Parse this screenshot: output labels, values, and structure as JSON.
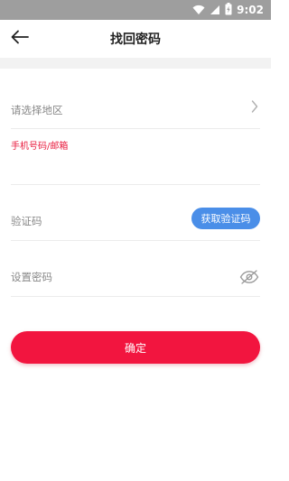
{
  "status_bar": {
    "time": "9:02",
    "icons": [
      "wifi-icon",
      "signal-icon",
      "battery-charging-icon"
    ],
    "background": "#9e9e9e"
  },
  "header": {
    "title": "找回密码",
    "back_icon": "arrow-left-icon"
  },
  "form": {
    "region": {
      "placeholder": "请选择地区",
      "icon": "chevron-right-icon"
    },
    "phone": {
      "label": "手机号码/邮箱",
      "value": "",
      "label_color": "#e8193c"
    },
    "code": {
      "placeholder": "验证码",
      "button_label": "获取验证码",
      "button_color": "#4a8ee8"
    },
    "password": {
      "placeholder": "设置密码",
      "icon": "eye-off-icon"
    }
  },
  "confirm": {
    "label": "确定",
    "color": "#f2153f"
  }
}
